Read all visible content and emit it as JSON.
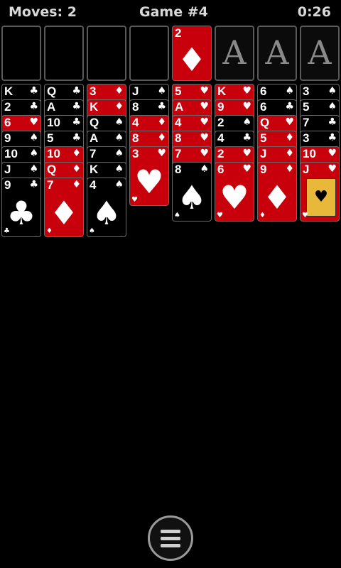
{
  "header": {
    "moves_text": "Moves: 2",
    "game_text": "Game #4",
    "time_text": "0:26"
  },
  "foundations": [
    {
      "type": "card",
      "rank": "2",
      "suit": "♦",
      "color": "red"
    },
    {
      "type": "empty",
      "label": "A"
    },
    {
      "type": "empty",
      "label": "A"
    },
    {
      "type": "empty",
      "label": "A"
    }
  ],
  "tableau": [
    [
      {
        "rank": "K",
        "suit": "♣",
        "color": "black"
      },
      {
        "rank": "2",
        "suit": "♣",
        "color": "black"
      },
      {
        "rank": "6",
        "suit": "♥",
        "color": "red"
      },
      {
        "rank": "9",
        "suit": "♠",
        "color": "black"
      },
      {
        "rank": "10",
        "suit": "♠",
        "color": "black"
      },
      {
        "rank": "J",
        "suit": "♠",
        "color": "black"
      },
      {
        "rank": "9",
        "suit": "♣",
        "color": "black"
      }
    ],
    [
      {
        "rank": "Q",
        "suit": "♣",
        "color": "black"
      },
      {
        "rank": "A",
        "suit": "♣",
        "color": "black"
      },
      {
        "rank": "10",
        "suit": "♣",
        "color": "black"
      },
      {
        "rank": "5",
        "suit": "♣",
        "color": "black"
      },
      {
        "rank": "10",
        "suit": "♦",
        "color": "red"
      },
      {
        "rank": "Q",
        "suit": "♦",
        "color": "red"
      },
      {
        "rank": "7",
        "suit": "♦",
        "color": "red"
      }
    ],
    [
      {
        "rank": "3",
        "suit": "♦",
        "color": "red"
      },
      {
        "rank": "K",
        "suit": "♦",
        "color": "red"
      },
      {
        "rank": "Q",
        "suit": "♠",
        "color": "black"
      },
      {
        "rank": "A",
        "suit": "♠",
        "color": "black"
      },
      {
        "rank": "7",
        "suit": "♠",
        "color": "black"
      },
      {
        "rank": "K",
        "suit": "♠",
        "color": "black"
      },
      {
        "rank": "4",
        "suit": "♠",
        "color": "black"
      }
    ],
    [
      {
        "rank": "J",
        "suit": "♠",
        "color": "black"
      },
      {
        "rank": "8",
        "suit": "♣",
        "color": "black"
      },
      {
        "rank": "4",
        "suit": "♦",
        "color": "red"
      },
      {
        "rank": "8",
        "suit": "♦",
        "color": "red"
      },
      {
        "rank": "3",
        "suit": "♥",
        "color": "red"
      }
    ],
    [
      {
        "rank": "5",
        "suit": "♥",
        "color": "red"
      },
      {
        "rank": "A",
        "suit": "♥",
        "color": "red"
      },
      {
        "rank": "4",
        "suit": "♥",
        "color": "red"
      },
      {
        "rank": "8",
        "suit": "♥",
        "color": "red"
      },
      {
        "rank": "7",
        "suit": "♥",
        "color": "red"
      },
      {
        "rank": "8",
        "suit": "♠",
        "color": "black"
      }
    ],
    [
      {
        "rank": "K",
        "suit": "♥",
        "color": "red"
      },
      {
        "rank": "9",
        "suit": "♥",
        "color": "red"
      },
      {
        "rank": "2",
        "suit": "♠",
        "color": "black"
      },
      {
        "rank": "4",
        "suit": "♣",
        "color": "black"
      },
      {
        "rank": "2",
        "suit": "♥",
        "color": "red"
      },
      {
        "rank": "6",
        "suit": "♥",
        "color": "red"
      }
    ],
    [
      {
        "rank": "6",
        "suit": "♠",
        "color": "black"
      },
      {
        "rank": "6",
        "suit": "♣",
        "color": "black"
      },
      {
        "rank": "Q",
        "suit": "♥",
        "color": "red"
      },
      {
        "rank": "5",
        "suit": "♦",
        "color": "red"
      },
      {
        "rank": "J",
        "suit": "♦",
        "color": "red"
      },
      {
        "rank": "9",
        "suit": "♦",
        "color": "red"
      }
    ],
    [
      {
        "rank": "3",
        "suit": "♠",
        "color": "black"
      },
      {
        "rank": "5",
        "suit": "♠",
        "color": "black"
      },
      {
        "rank": "7",
        "suit": "♣",
        "color": "black"
      },
      {
        "rank": "3",
        "suit": "♣",
        "color": "black"
      },
      {
        "rank": "10",
        "suit": "♥",
        "color": "red"
      },
      {
        "rank": "J",
        "suit": "♥",
        "color": "red"
      }
    ]
  ],
  "icons": {
    "menu": "menu-icon"
  },
  "colors": {
    "red_card": "#c8000c",
    "black_card": "#000000",
    "background": "#000000"
  }
}
